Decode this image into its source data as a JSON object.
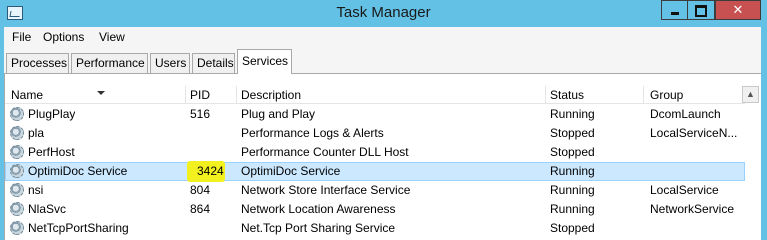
{
  "window": {
    "title": "Task Manager",
    "controls": {
      "minimize": "",
      "maximize": "",
      "close": "✕"
    }
  },
  "menu": [
    "File",
    "Options",
    "View"
  ],
  "tabs": [
    {
      "label": "Processes",
      "active": false
    },
    {
      "label": "Performance",
      "active": false
    },
    {
      "label": "Users",
      "active": false
    },
    {
      "label": "Details",
      "active": false
    },
    {
      "label": "Services",
      "active": true
    }
  ],
  "columns": {
    "name": "Name",
    "pid": "PID",
    "description": "Description",
    "status": "Status",
    "group": "Group"
  },
  "sort_indicator": "descending on Name",
  "scroll_up_glyph": "▲",
  "rows": [
    {
      "name": "PlugPlay",
      "pid": "516",
      "description": "Plug and Play",
      "status": "Running",
      "group": "DcomLaunch"
    },
    {
      "name": "pla",
      "pid": "",
      "description": "Performance Logs & Alerts",
      "status": "Stopped",
      "group": "LocalServiceN..."
    },
    {
      "name": "PerfHost",
      "pid": "",
      "description": "Performance Counter DLL Host",
      "status": "Stopped",
      "group": ""
    },
    {
      "name": "OptimiDoc Service",
      "pid": "3424",
      "description": "OptimiDoc Service",
      "status": "Running",
      "group": "",
      "selected": true,
      "pid_highlight": true
    },
    {
      "name": "nsi",
      "pid": "804",
      "description": "Network Store Interface Service",
      "status": "Running",
      "group": "LocalService"
    },
    {
      "name": "NlaSvc",
      "pid": "864",
      "description": "Network Location Awareness",
      "status": "Running",
      "group": "NetworkService"
    },
    {
      "name": "NetTcpPortSharing",
      "pid": "",
      "description": "Net.Tcp Port Sharing Service",
      "status": "Stopped",
      "group": ""
    }
  ],
  "colors": {
    "titlebar": "#62c1e5",
    "close_button": "#c75050",
    "selection": "#cce8ff",
    "highlight": "#f2f01f"
  }
}
